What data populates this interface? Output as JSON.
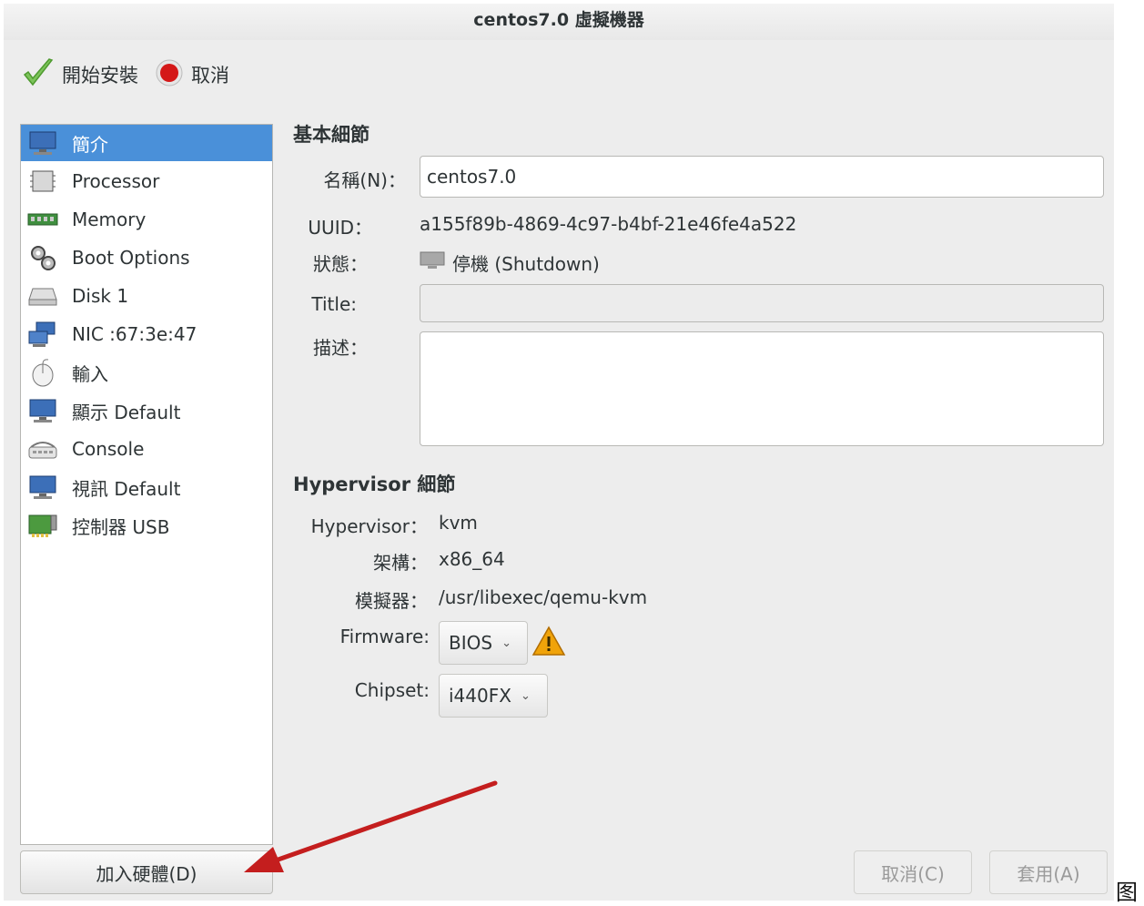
{
  "window": {
    "title": "centos7.0 虛擬機器"
  },
  "toolbar": {
    "begin_install": "開始安裝",
    "cancel": "取消"
  },
  "sidebar": {
    "items": [
      {
        "label": "簡介",
        "icon": "monitor-icon"
      },
      {
        "label": "Processor",
        "icon": "cpu-icon"
      },
      {
        "label": "Memory",
        "icon": "memory-icon"
      },
      {
        "label": "Boot Options",
        "icon": "gears-icon"
      },
      {
        "label": "Disk 1",
        "icon": "disk-icon"
      },
      {
        "label": "NIC :67:3e:47",
        "icon": "network-icon"
      },
      {
        "label": "輸入",
        "icon": "mouse-icon"
      },
      {
        "label": "顯示 Default",
        "icon": "display-icon"
      },
      {
        "label": "Console",
        "icon": "console-icon"
      },
      {
        "label": "視訊 Default",
        "icon": "video-icon"
      },
      {
        "label": "控制器 USB",
        "icon": "controller-icon"
      }
    ],
    "add_hardware": "加入硬體(D)",
    "selected_index": 0
  },
  "basic": {
    "title": "基本細節",
    "name_label": "名稱(N)：",
    "name_value": "centos7.0",
    "uuid_label": "UUID：",
    "uuid_value": "a155f89b-4869-4c97-b4bf-21e46fe4a522",
    "status_label": "狀態：",
    "status_value": "停機 (Shutdown)",
    "title_label": "Title:",
    "title_value": "",
    "desc_label": "描述：",
    "desc_value": ""
  },
  "hypervisor": {
    "title": "Hypervisor 細節",
    "hv_label": "Hypervisor：",
    "hv_value": "kvm",
    "arch_label": "架構：",
    "arch_value": "x86_64",
    "emu_label": "模擬器：",
    "emu_value": "/usr/libexec/qemu-kvm",
    "firmware_label": "Firmware:",
    "firmware_value": "BIOS",
    "chipset_label": "Chipset:",
    "chipset_value": "i440FX"
  },
  "footer": {
    "cancel": "取消(C)",
    "apply": "套用(A)"
  },
  "annotation": {
    "char": "图"
  },
  "colors": {
    "selection": "#4a90d9",
    "arrow": "#c41e1e",
    "warning": "#f0a30a"
  }
}
